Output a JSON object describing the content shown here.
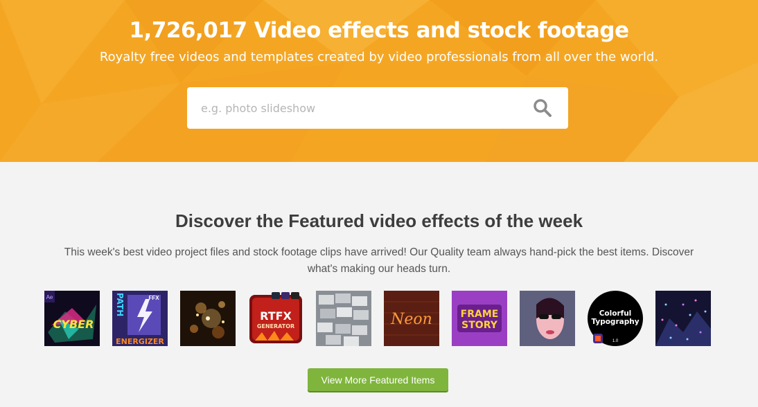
{
  "hero": {
    "title": "1,726,017 Video effects and stock footage",
    "subtitle": "Royalty free videos and templates created by video professionals from all over the world.",
    "accent_color": "#f4a623"
  },
  "search": {
    "placeholder": "e.g. photo slideshow",
    "value": "",
    "icon": "search-icon"
  },
  "featured": {
    "title": "Discover the Featured video effects of the week",
    "description_line1": "This week's best video project files and stock footage clips have arrived! Our Quality team always hand-pick the best items. Discover",
    "description_line2": "what's making our heads turn.",
    "thumbnails": [
      {
        "name": "glitch-cyber-thumbnail",
        "badge": "Ae",
        "text": "CYBER"
      },
      {
        "name": "path-energizer-thumbnail",
        "top_text": "PATH",
        "badge": "FFX",
        "bottom_text": "ENERGIZER"
      },
      {
        "name": "golden-particles-thumbnail"
      },
      {
        "name": "rtfx-generator-thumbnail",
        "text": "RTFX",
        "sub_text": "GENERATOR"
      },
      {
        "name": "stacked-tiles-thumbnail"
      },
      {
        "name": "neon-sign-thumbnail",
        "text": "Neon"
      },
      {
        "name": "frame-story-thumbnail",
        "text_line1": "FRAME",
        "text_line2": "STORY"
      },
      {
        "name": "neon-portrait-thumbnail"
      },
      {
        "name": "colorful-typography-thumbnail",
        "text_line1": "Colorful",
        "text_line2": "Typography",
        "version": "1.0"
      },
      {
        "name": "city-night-lights-thumbnail"
      }
    ],
    "more_button": "View More Featured Items",
    "button_color": "#7fb53c"
  }
}
